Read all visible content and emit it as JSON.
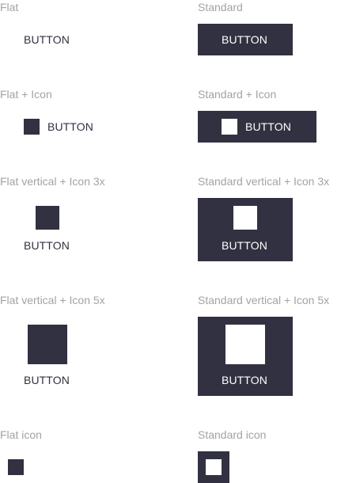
{
  "captions": {
    "flat": "Flat",
    "standard": "Standard",
    "flat_icon_combo": "Flat + Icon",
    "standard_icon_combo": "Standard + Icon",
    "flat_vertical_3x": "Flat vertical + Icon 3x",
    "standard_vertical_3x": "Standard vertical + Icon 3x",
    "flat_vertical_5x": "Flat vertical + Icon 5x",
    "standard_vertical_5x": "Standard vertical + Icon 5x",
    "flat_icon": "Flat icon",
    "standard_icon": "Standard icon"
  },
  "buttons": {
    "label": "BUTTON"
  },
  "icons": {
    "shape": "square-icon"
  },
  "colors": {
    "button_dark": "#313141",
    "caption_gray": "#a2a3a8",
    "background": "#ffffff",
    "on_dark": "#ffffff"
  }
}
